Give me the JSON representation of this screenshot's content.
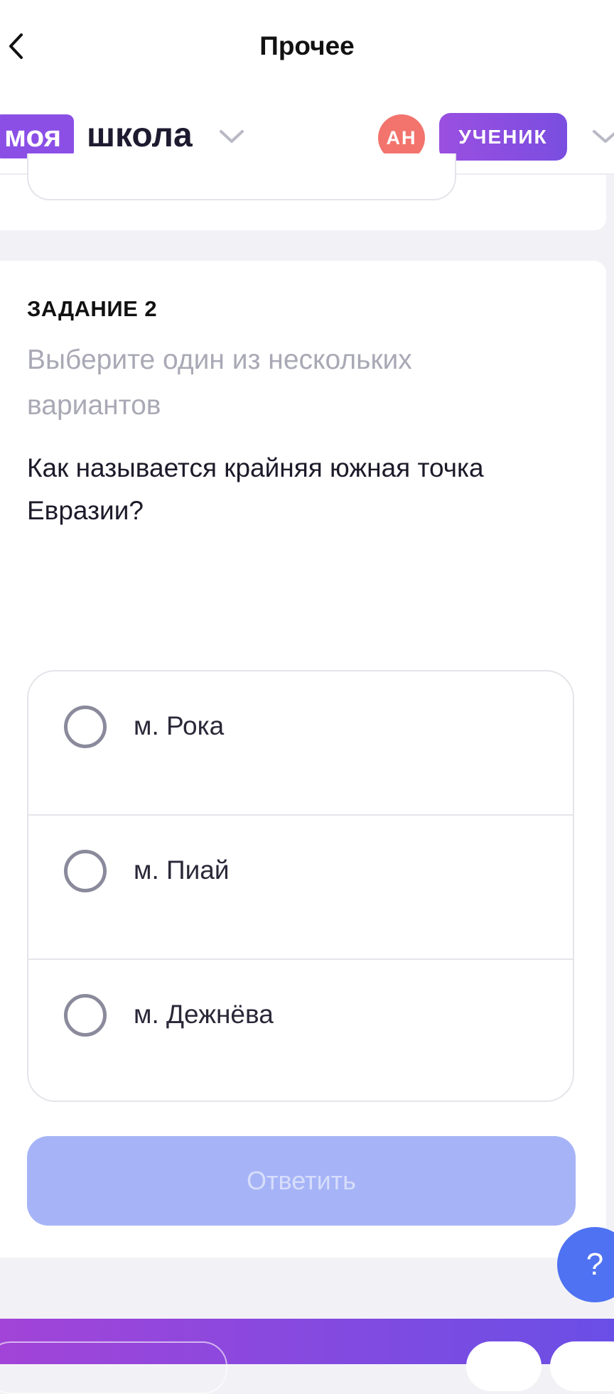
{
  "header": {
    "title": "Прочее",
    "back_icon": "chevron-left-icon"
  },
  "brand": {
    "logo_part1": "моя",
    "logo_part2": "школа",
    "avatar_initials": "АН",
    "role": "УЧЕНИК",
    "accent_color": "#8b4fe6"
  },
  "task": {
    "number": "ЗАДАНИЕ 2",
    "instruction": "Выберите один из нескольких вариантов",
    "question": "Как называется крайняя южная точка Евразии?",
    "options": [
      {
        "label": "м. Рока"
      },
      {
        "label": "м. Пиай"
      },
      {
        "label": "м. Дежнёва"
      }
    ],
    "submit_label": "Ответить"
  },
  "help": {
    "label": "?"
  }
}
